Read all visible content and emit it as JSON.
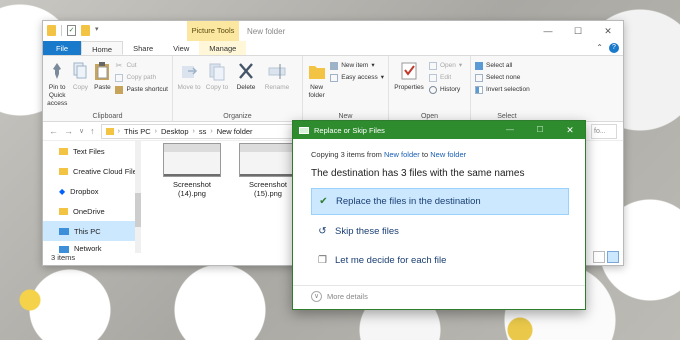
{
  "window": {
    "title": "New folder",
    "context_tab": "Picture Tools",
    "controls": {
      "minimize": "—",
      "maximize": "☐",
      "close": "✕"
    }
  },
  "tabs": [
    {
      "label": "File"
    },
    {
      "label": "Home"
    },
    {
      "label": "Share"
    },
    {
      "label": "View"
    },
    {
      "label": "Manage"
    }
  ],
  "ribbon": {
    "clipboard": {
      "label": "Clipboard",
      "pin": "Pin to Quick access",
      "copy": "Copy",
      "paste": "Paste",
      "cut": "Cut",
      "copy_path": "Copy path",
      "paste_shortcut": "Paste shortcut"
    },
    "organize": {
      "label": "Organize",
      "move_to": "Move to",
      "copy_to": "Copy to",
      "delete": "Delete",
      "rename": "Rename"
    },
    "new": {
      "label": "New",
      "new_folder": "New folder",
      "new_item": "New item",
      "easy_access": "Easy access"
    },
    "open": {
      "label": "Open",
      "properties": "Properties",
      "open": "Open",
      "edit": "Edit",
      "history": "History"
    },
    "select": {
      "label": "Select",
      "select_all": "Select all",
      "select_none": "Select none",
      "invert_selection": "Invert selection"
    }
  },
  "address": {
    "crumbs": [
      "This PC",
      "Desktop",
      "ss",
      "New folder"
    ],
    "search_placeholder": "fo..."
  },
  "sidebar": {
    "items": [
      {
        "label": "Text Files",
        "icon": "folder-icon"
      },
      {
        "label": "Creative Cloud File",
        "icon": "creative-cloud-icon"
      },
      {
        "label": "Dropbox",
        "icon": "dropbox-icon"
      },
      {
        "label": "OneDrive",
        "icon": "onedrive-icon"
      },
      {
        "label": "This PC",
        "icon": "computer-icon"
      },
      {
        "label": "Network",
        "icon": "network-icon"
      }
    ]
  },
  "files": [
    {
      "name": "Screenshot (14).png"
    },
    {
      "name": "Screenshot (15).png"
    }
  ],
  "status": {
    "count": "3 items"
  },
  "dialog": {
    "title": "Replace or Skip Files",
    "copying_prefix": "Copying 3 items from",
    "from": "New folder",
    "to_word": "to",
    "to": "New folder",
    "headline": "The destination has 3 files with the same names",
    "options": {
      "replace": "Replace the files in the destination",
      "skip": "Skip these files",
      "decide": "Let me decide for each file"
    },
    "more_details": "More details"
  },
  "colors": {
    "accent": "#1979ca",
    "dialog_title": "#2e8b2e",
    "selection": "#cce8ff",
    "picture_tools": "#fbe7a0"
  }
}
